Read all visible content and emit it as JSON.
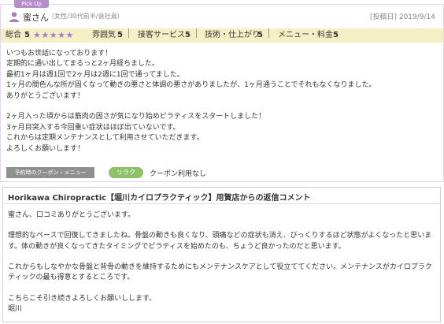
{
  "pickup_tag": "Pick Up",
  "reviewer": {
    "name": "蜜さん",
    "profile": "（女性/30代前半/会社員）",
    "posted_date": "[投稿日] 2019/9/14"
  },
  "ratings": {
    "overall_label": "総合",
    "overall_score": "5",
    "stars": "★★★★★",
    "stars_value": 5,
    "items": [
      {
        "label": "雰囲気",
        "score": "5"
      },
      {
        "label": "接客サービス",
        "score": "5"
      },
      {
        "label": "技術・仕上がり",
        "score": "5"
      },
      {
        "label": "メニュー・料金",
        "score": "5"
      }
    ]
  },
  "review_text": "いつもお世話になっております！\n定期的に通い出してまるっと2ヶ月経ちました。\n最初1ヶ月は週1回で2ヶ月は2週に1回で通ってました。\n1ヶ月の間色んな所が固くなって動きの悪さと体調の悪さがありましたが、1ヶ月通うことでそれもなくなりました。\nありがとうございます！\n\n2ヶ月入った頃からは筋肉の固さが気になり始めピラティスをスタートしました！\n3ヶ月目突入する今回重い症状はほぼ出ていないです。\nこれからは定期メンテナンスとして利用させていただきます。\nよろしくお願いします！",
  "coupon": {
    "label": "予約時のクーポン・メニュー",
    "badge": "リラク",
    "usage": "クーポン利用なし"
  },
  "reply": {
    "title": "Horikawa Chiropractic【堀川カイロプラクティック】用賀店からの返信コメント",
    "body": "蜜さん、口コミありがとうございます。\n\n理想的なペースで回復してきましたね。骨盤の動きも良くなり、頭痛などの症状も消え、びっくりするほど状態がよくなったと思います。体の動きが良くなってきたタイミングでピラティスを始めたのも、ちょうど良かったのだと思います。\n\nこれからもしなやかな骨盤と背骨の動きを維持するためにもメンテナンスケアとして役立ててください。メンテナンスがカイロプラクティックの最も得意とするところです。\n\nこちらこそ引き続きよろしくお願いしします。\n堀川"
  },
  "colors": {
    "accent": "#a27fc8",
    "rating_bg": "#f6efc6",
    "badge_green": "#8fc06a"
  }
}
